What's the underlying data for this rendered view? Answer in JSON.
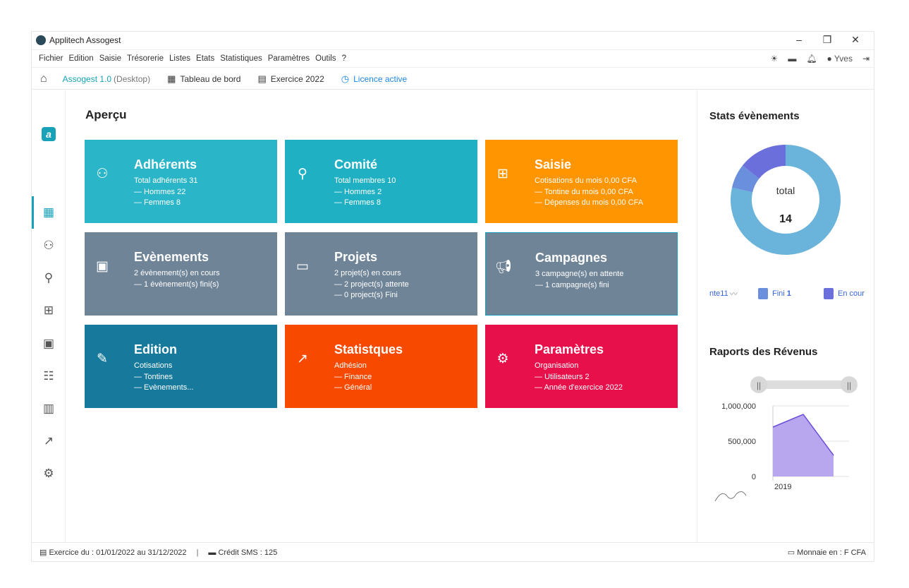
{
  "window": {
    "title": "Applitech Assogest",
    "controls": [
      "–",
      "❐",
      "✕"
    ]
  },
  "menubar": {
    "items": [
      "Fichier",
      "Edition",
      "Saisie",
      "Trésorerie",
      "Listes",
      "Etats",
      "Statistiques",
      "Paramètres",
      "Outils",
      "?"
    ],
    "user": "Yves"
  },
  "toolbar": {
    "brand": "Assogest 1.0",
    "brand_sub": "(Desktop)",
    "dashboard": "Tableau de bord",
    "exercise": "Exercice 2022",
    "licence": "Licence active"
  },
  "main": {
    "title": "Aperçu",
    "tiles": [
      {
        "title": "Adhérents",
        "lines": [
          "Total adhérents 31",
          "— Hommes 22",
          "— Femmes 8"
        ],
        "color": "#2bb5c8",
        "icon": "users-icon"
      },
      {
        "title": "Comité",
        "lines": [
          "Total membres 10",
          "— Hommes 2",
          "— Femmes 8"
        ],
        "color": "#20b0c4",
        "icon": "committee-icon"
      },
      {
        "title": "Saisie",
        "lines": [
          "Cotisations du mois 0,00 CFA",
          "— Tontine du mois 0,00 CFA",
          "— Dépenses du mois 0,00 CFA"
        ],
        "color": "#ff9500",
        "icon": "calculator-icon"
      },
      {
        "title": "Evènements",
        "lines": [
          "2 évènement(s) en cours",
          "— 1 évènement(s) fini(s)"
        ],
        "color": "#708498",
        "icon": "calendar-icon"
      },
      {
        "title": "Projets",
        "lines": [
          "2 projet(s) en cours",
          "— 2 project(s) attente",
          "— 0 project(s) Fini"
        ],
        "color": "#708498",
        "icon": "folder-icon"
      },
      {
        "title": "Campagnes",
        "lines": [
          "3 campagne(s) en attente",
          "— 1 campagne(s) fini"
        ],
        "color": "#708498",
        "icon": "megaphone-icon"
      },
      {
        "title": "Edition",
        "lines": [
          "Cotisations",
          "— Tontines",
          "— Evènements..."
        ],
        "color": "#17799c",
        "icon": "pencil-icon"
      },
      {
        "title": "Statistques",
        "lines": [
          "Adhésion",
          "— Finance",
          "— Général"
        ],
        "color": "#f74a00",
        "icon": "trend-icon"
      },
      {
        "title": "Paramètres",
        "lines": [
          "Organisation",
          "— Utilisateurs 2",
          "— Année d'exercice 2022"
        ],
        "color": "#e8104a",
        "icon": "gear-icon"
      }
    ]
  },
  "right_panel": {
    "events_title": "Stats évènements",
    "donut_label": "total",
    "donut_total": "14",
    "legend": [
      {
        "label": "nte",
        "count": "11",
        "color": "#6ab4dc"
      },
      {
        "label": "Fini",
        "count": "1",
        "color": "#6a8fdc"
      },
      {
        "label": "En cour",
        "count": "",
        "color": "#6a6fdc"
      }
    ],
    "revenue_title": "Raports des Révenus"
  },
  "chart_data": [
    {
      "type": "pie",
      "title": "Stats évènements",
      "categories": [
        "nte",
        "Fini",
        "En cour"
      ],
      "values": [
        11,
        1,
        2
      ],
      "colors": [
        "#6ab4dc",
        "#6a8fdc",
        "#6a6fdc"
      ]
    },
    {
      "type": "area",
      "title": "Raports des Révenus",
      "x_tick_labels": [
        "2019"
      ],
      "y_tick_labels": [
        "1,000,000",
        "500,000",
        "0"
      ],
      "ylim": [
        0,
        1000000
      ],
      "series": [
        {
          "values": [
            700000,
            880000,
            300000
          ],
          "color": "#b8a6ee"
        }
      ]
    }
  ],
  "statusbar": {
    "exercise_range": "Exercice du : 01/01/2022 au 31/12/2022",
    "sep": "|",
    "sms_credit": "Crédit SMS : 125",
    "currency": "Monnaie en : F CFA"
  }
}
